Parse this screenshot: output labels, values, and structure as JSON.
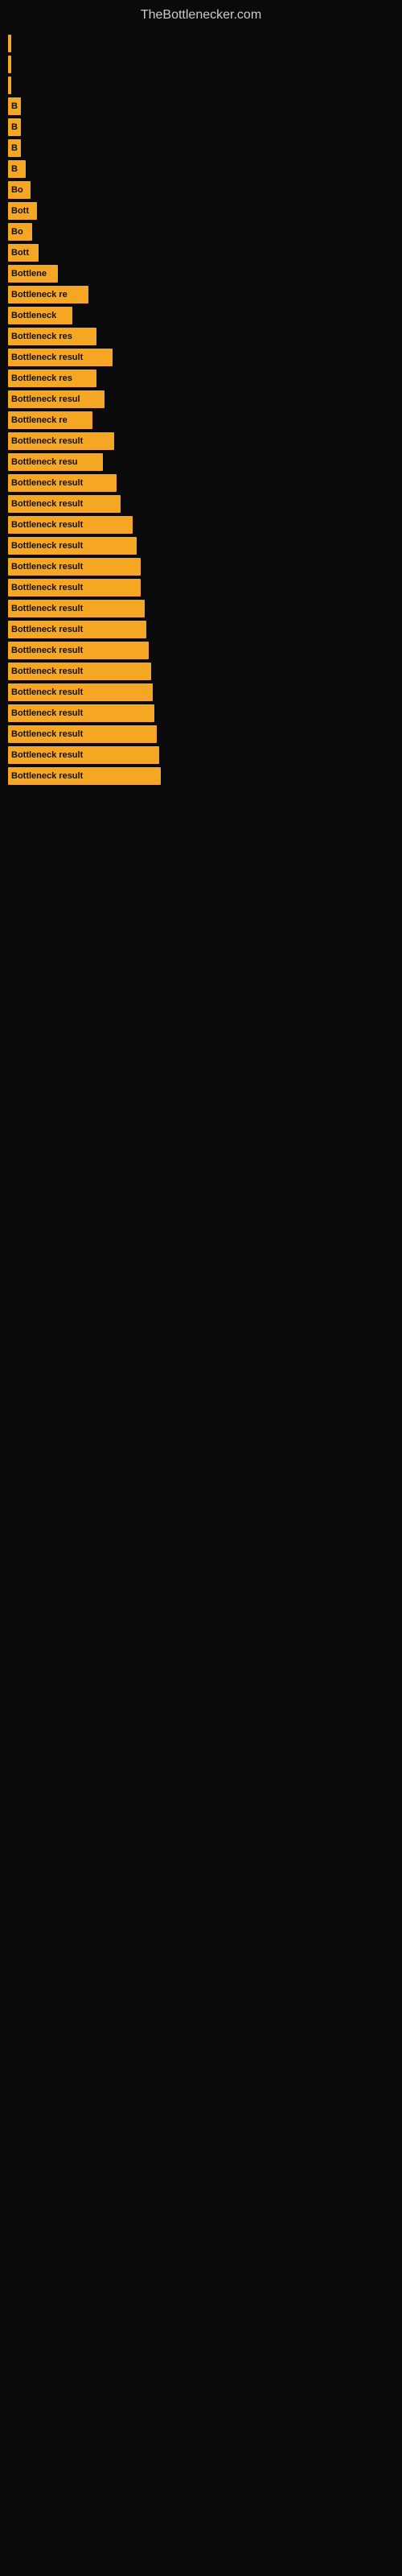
{
  "site_title": "TheBottlenecker.com",
  "bars": [
    {
      "label": "",
      "width": 4
    },
    {
      "label": "",
      "width": 4
    },
    {
      "label": "",
      "width": 4
    },
    {
      "label": "B",
      "width": 16
    },
    {
      "label": "B",
      "width": 16
    },
    {
      "label": "B",
      "width": 16
    },
    {
      "label": "B",
      "width": 22
    },
    {
      "label": "Bo",
      "width": 28
    },
    {
      "label": "Bott",
      "width": 36
    },
    {
      "label": "Bo",
      "width": 30
    },
    {
      "label": "Bott",
      "width": 38
    },
    {
      "label": "Bottlene",
      "width": 62
    },
    {
      "label": "Bottleneck re",
      "width": 100
    },
    {
      "label": "Bottleneck",
      "width": 80
    },
    {
      "label": "Bottleneck res",
      "width": 110
    },
    {
      "label": "Bottleneck result",
      "width": 130
    },
    {
      "label": "Bottleneck res",
      "width": 110
    },
    {
      "label": "Bottleneck resul",
      "width": 120
    },
    {
      "label": "Bottleneck re",
      "width": 105
    },
    {
      "label": "Bottleneck result",
      "width": 132
    },
    {
      "label": "Bottleneck resu",
      "width": 118
    },
    {
      "label": "Bottleneck result",
      "width": 135
    },
    {
      "label": "Bottleneck result",
      "width": 140
    },
    {
      "label": "Bottleneck result",
      "width": 155
    },
    {
      "label": "Bottleneck result",
      "width": 160
    },
    {
      "label": "Bottleneck result",
      "width": 165
    },
    {
      "label": "Bottleneck result",
      "width": 165
    },
    {
      "label": "Bottleneck result",
      "width": 170
    },
    {
      "label": "Bottleneck result",
      "width": 172
    },
    {
      "label": "Bottleneck result",
      "width": 175
    },
    {
      "label": "Bottleneck result",
      "width": 178
    },
    {
      "label": "Bottleneck result",
      "width": 180
    },
    {
      "label": "Bottleneck result",
      "width": 182
    },
    {
      "label": "Bottleneck result",
      "width": 185
    },
    {
      "label": "Bottleneck result",
      "width": 188
    },
    {
      "label": "Bottleneck result",
      "width": 190
    }
  ]
}
